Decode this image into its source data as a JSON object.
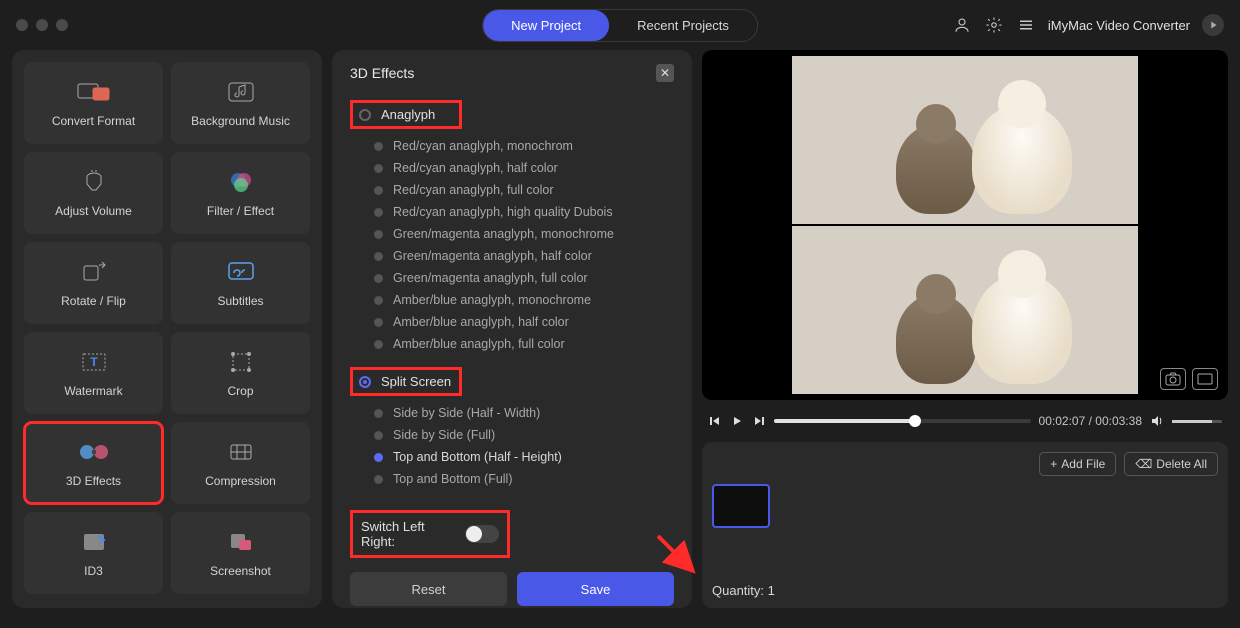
{
  "titlebar": {
    "tabs": {
      "newProject": "New Project",
      "recentProjects": "Recent Projects"
    },
    "appName": "iMyMac Video Converter"
  },
  "tools": [
    {
      "id": "convert-format",
      "label": "Convert Format"
    },
    {
      "id": "background-music",
      "label": "Background Music"
    },
    {
      "id": "adjust-volume",
      "label": "Adjust Volume"
    },
    {
      "id": "filter-effect",
      "label": "Filter / Effect"
    },
    {
      "id": "rotate-flip",
      "label": "Rotate / Flip"
    },
    {
      "id": "subtitles",
      "label": "Subtitles"
    },
    {
      "id": "watermark",
      "label": "Watermark"
    },
    {
      "id": "crop",
      "label": "Crop"
    },
    {
      "id": "3d-effects",
      "label": "3D Effects"
    },
    {
      "id": "compression",
      "label": "Compression"
    },
    {
      "id": "id3",
      "label": "ID3"
    },
    {
      "id": "screenshot",
      "label": "Screenshot"
    }
  ],
  "effects": {
    "title": "3D Effects",
    "anaglyph": {
      "label": "Anaglyph",
      "options": [
        "Red/cyan anaglyph, monochrom",
        "Red/cyan anaglyph, half color",
        "Red/cyan anaglyph, full color",
        "Red/cyan anaglyph, high quality Dubois",
        "Green/magenta anaglyph, monochrome",
        "Green/magenta anaglyph, half color",
        "Green/magenta anaglyph, full color",
        "Amber/blue anaglyph, monochrome",
        "Amber/blue anaglyph, half color",
        "Amber/blue anaglyph, full color"
      ]
    },
    "splitScreen": {
      "label": "Split Screen",
      "options": [
        "Side by Side (Half - Width)",
        "Side by Side (Full)",
        "Top and Bottom (Half - Height)",
        "Top and Bottom (Full)"
      ],
      "selectedIndex": 2
    },
    "switchLabel": "Switch Left Right:",
    "resetLabel": "Reset",
    "saveLabel": "Save"
  },
  "player": {
    "currentTime": "00:02:07",
    "totalTime": "00:03:38"
  },
  "files": {
    "addFileLabel": "Add File",
    "deleteAllLabel": "Delete All",
    "quantityLabel": "Quantity: 1"
  }
}
